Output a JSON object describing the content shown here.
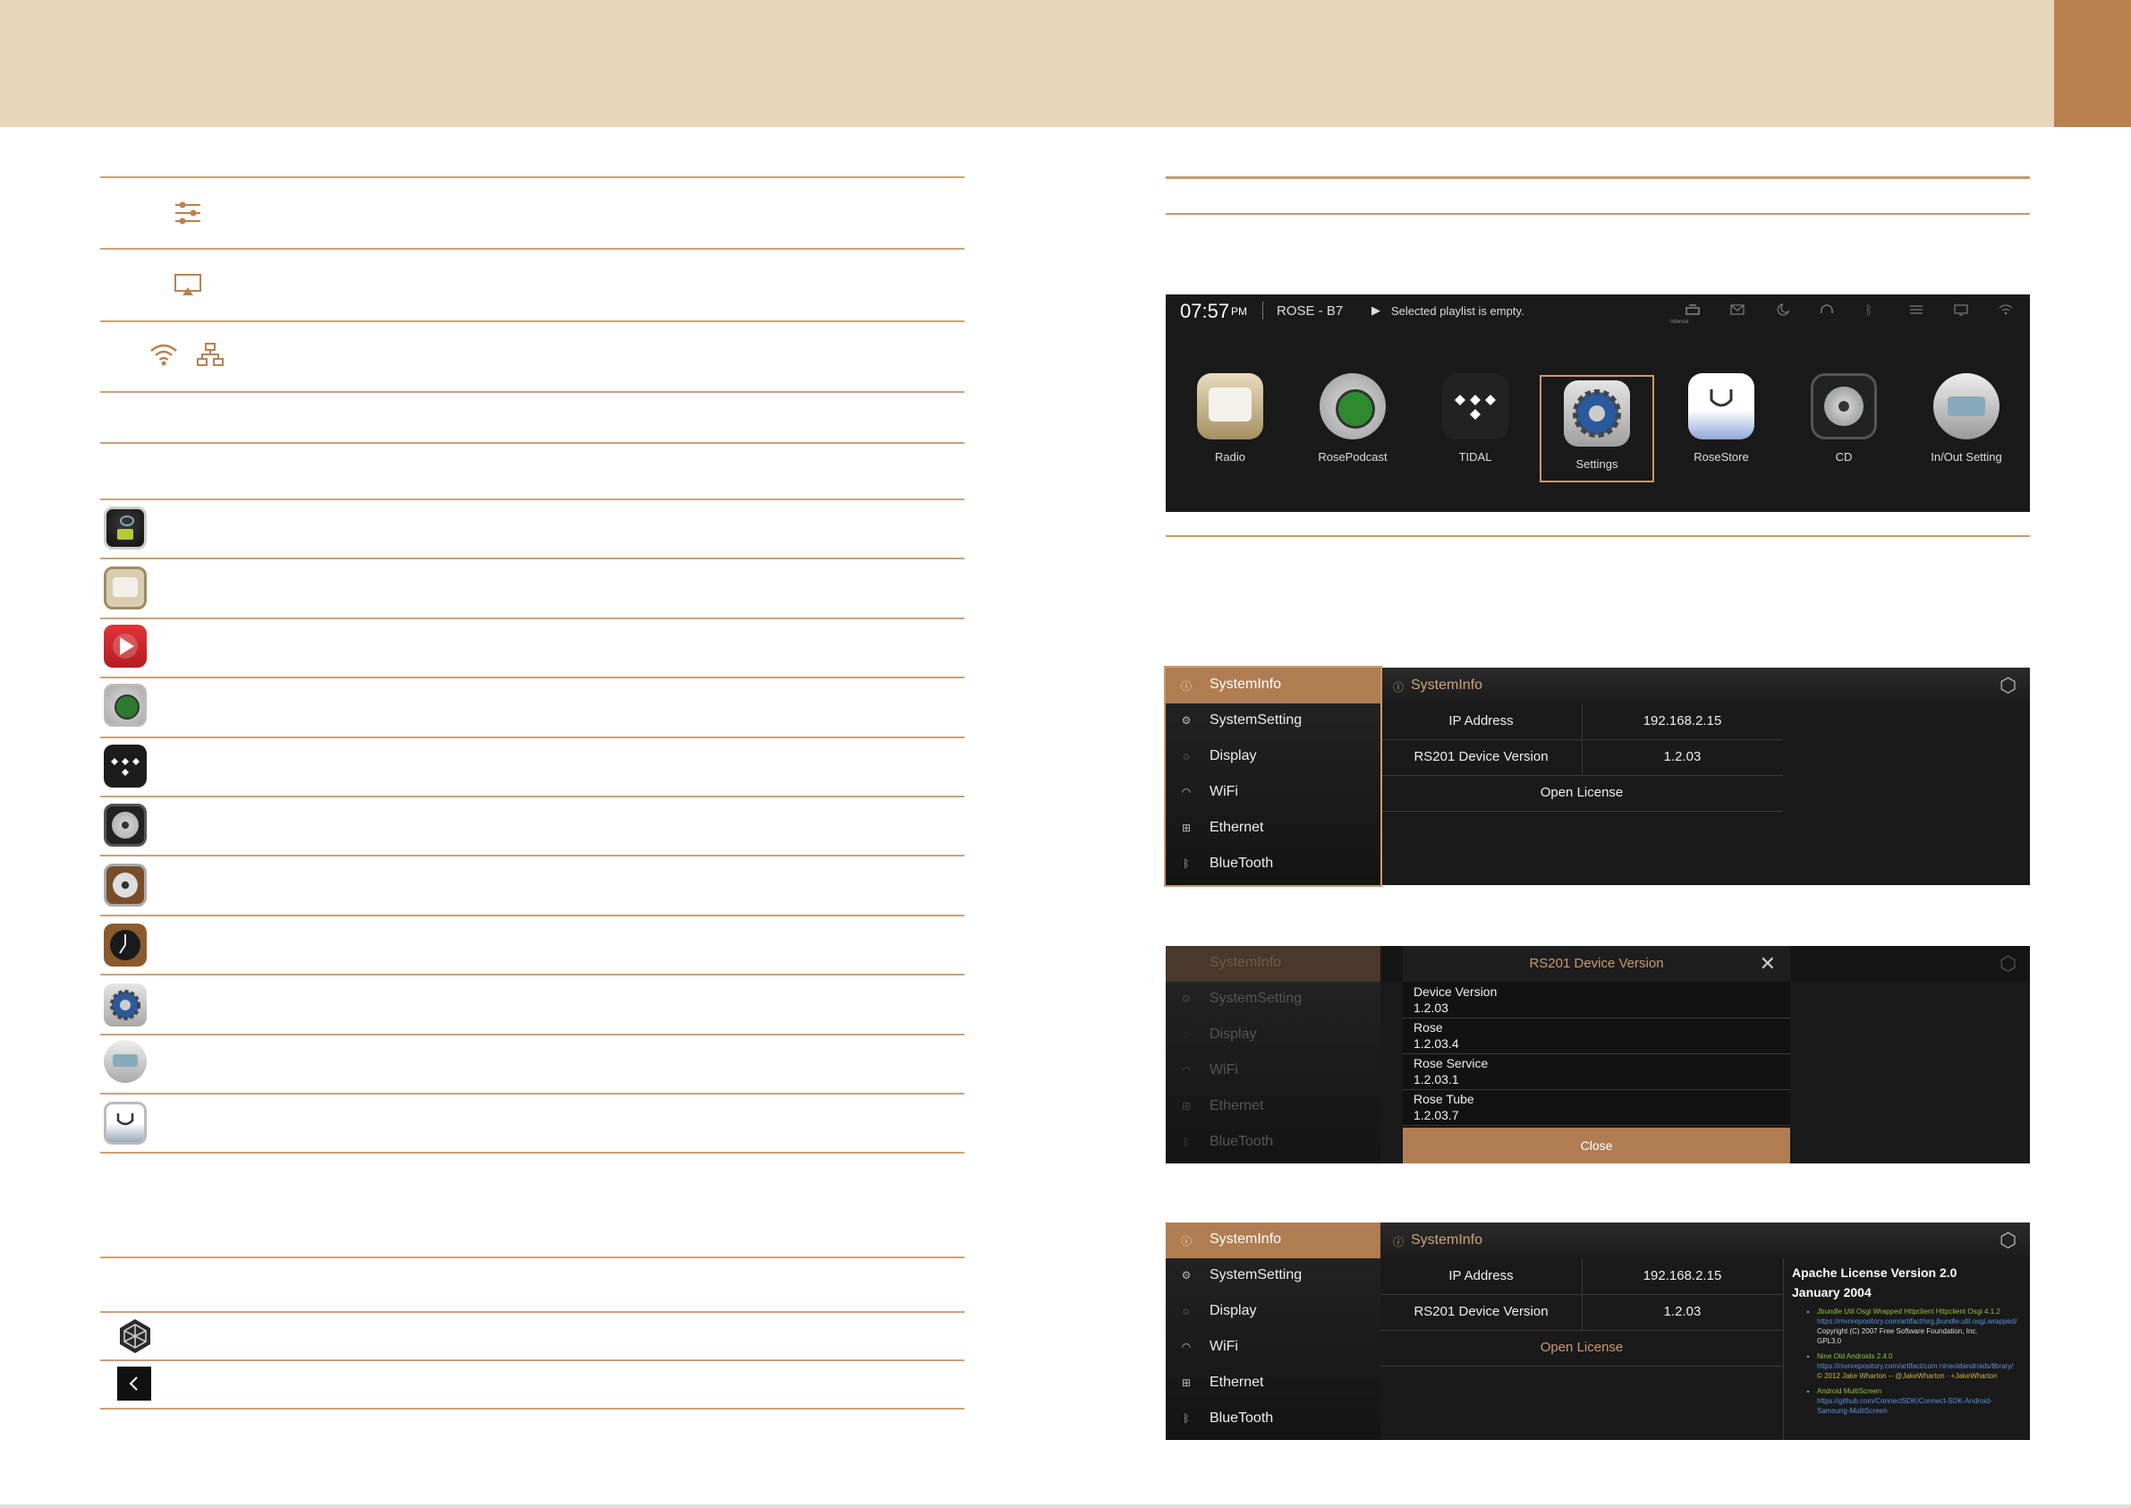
{
  "colors": {
    "accent": "#b07d52",
    "band": "#e8d6bb",
    "tab": "#b8824f",
    "line": "#c9a27a",
    "screen_bg": "#1a1a1a"
  },
  "left_icons": {
    "row1": "sliders-icon",
    "row2": "airplay-icon",
    "row3a": "wifi-icon",
    "row3b": "network-icon",
    "apps": [
      "music-app-icon",
      "radio-app-icon",
      "video-play-app-icon",
      "rose-podcast-app-icon",
      "tidal-app-icon",
      "cd-app-icon",
      "film-reel-app-icon",
      "clock-app-icon",
      "settings-app-icon",
      "in-out-setting-app-icon",
      "rose-store-app-icon"
    ],
    "bottom": [
      "rose-logo-icon",
      "back-arrow-icon"
    ]
  },
  "launcher": {
    "time": "07:57",
    "ampm": "PM",
    "device": "ROSE - B7",
    "play_symbol": "▶",
    "status": "Selected playlist is empty.",
    "internal_label": "Internal",
    "apps": [
      {
        "label": "Radio"
      },
      {
        "label": "RosePodcast"
      },
      {
        "label": "TIDAL"
      },
      {
        "label": "Settings",
        "selected": true
      },
      {
        "label": "RoseStore"
      },
      {
        "label": "CD"
      },
      {
        "label": "In/Out Setting"
      }
    ]
  },
  "menu": {
    "items": [
      {
        "label": "SystemInfo",
        "icon": "info-icon"
      },
      {
        "label": "SystemSetting",
        "icon": "gear-icon"
      },
      {
        "label": "Display",
        "icon": "display-icon"
      },
      {
        "label": "WiFi",
        "icon": "wifi-icon"
      },
      {
        "label": "Ethernet",
        "icon": "ethernet-icon"
      },
      {
        "label": "BlueTooth",
        "icon": "bluetooth-icon"
      }
    ]
  },
  "sysinfo": {
    "title": "SystemInfo",
    "ip_label": "IP Address",
    "ip_value": "192.168.2.15",
    "ver_label": "RS201 Device Version",
    "ver_value": "1.2.03",
    "license": "Open License"
  },
  "dialog": {
    "title": "RS201 Device Version",
    "close_symbol": "✕",
    "rows": [
      {
        "k": "Device Version",
        "v": "1.2.03"
      },
      {
        "k": "Rose",
        "v": "1.2.03.4"
      },
      {
        "k": "Rose Service",
        "v": "1.2.03.1"
      },
      {
        "k": "Rose Tube",
        "v": "1.2.03.7"
      }
    ],
    "button": "Close"
  },
  "license": {
    "title": "Apache License Version 2.0",
    "date": "January 2004",
    "items": [
      {
        "name": "Jbundle Util Osgi Wrapped Httpclient Httpclient Osgi 4.1.2",
        "url": "https://mvnrepository.com/artifact/org.jbundle.util.osgi.wrapped/",
        "copy": "Copyright (C) 2007 Free Software Foundation, Inc.",
        "extra": "GPL3.0"
      },
      {
        "name": "Nine Old Androids 2.4.0",
        "url": "https://mvnrepository.com/artifact/com.nineoldandroids/library/",
        "copy": "© 2012 Jake Wharton -- @JakeWharton · +JakeWharton",
        "extra": ""
      },
      {
        "name": "Android MultiScreen",
        "url": "https://github.com/ConnectSDK/Connect-SDK-Android-Samsung-MultiScreen",
        "copy": "",
        "extra": ""
      }
    ]
  }
}
